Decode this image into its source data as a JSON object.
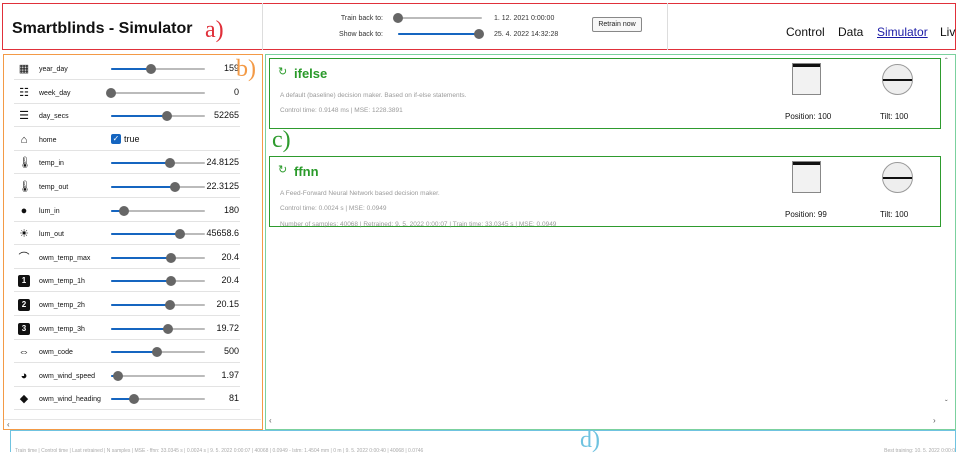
{
  "header": {
    "app_title": "Smartblinds - Simulator",
    "train_back_label": "Train back to:",
    "train_back_value": "1. 12. 2021 0:00:00",
    "show_back_label": "Show back to:",
    "show_back_value": "25. 4. 2022 14:32:28",
    "train_back_slider_fraction": 0.0,
    "show_back_slider_fraction": 0.97,
    "retrain_button": "Retrain now",
    "nav": [
      "Control",
      "Data",
      "Simulator",
      "Liv"
    ],
    "active_nav": "Simulator"
  },
  "annotations": {
    "a": "a)",
    "b": "b)",
    "c": "c)",
    "d": "d)"
  },
  "features": [
    {
      "name": "year_day",
      "icon": "calendar-icon",
      "value": "159",
      "fraction": 0.43
    },
    {
      "name": "week_day",
      "icon": "week-icon",
      "value": "0",
      "fraction": 0.0
    },
    {
      "name": "day_secs",
      "icon": "bars-icon",
      "value": "52265",
      "fraction": 0.6
    },
    {
      "name": "home",
      "icon": "home-icon",
      "checkbox": true,
      "value": "true"
    },
    {
      "name": "temp_in",
      "icon": "thermometer-icon",
      "value": "24.8125",
      "fraction": 0.63
    },
    {
      "name": "temp_out",
      "icon": "thermometer-out-icon",
      "value": "22.3125",
      "fraction": 0.68
    },
    {
      "name": "lum_in",
      "icon": "bulb-icon",
      "value": "180",
      "fraction": 0.14
    },
    {
      "name": "lum_out",
      "icon": "sun-icon",
      "value": "45658.6",
      "fraction": 0.73
    },
    {
      "name": "owm_temp_max",
      "icon": "arc-icon",
      "value": "20.4",
      "fraction": 0.64
    },
    {
      "name": "owm_temp_1h",
      "icon": "box-1-icon",
      "value": "20.4",
      "fraction": 0.64
    },
    {
      "name": "owm_temp_2h",
      "icon": "box-2-icon",
      "value": "20.15",
      "fraction": 0.63
    },
    {
      "name": "owm_temp_3h",
      "icon": "box-3-icon",
      "value": "19.72",
      "fraction": 0.61
    },
    {
      "name": "owm_code",
      "icon": "code-icon",
      "value": "500",
      "fraction": 0.49
    },
    {
      "name": "owm_wind_speed",
      "icon": "gauge-icon",
      "value": "1.97",
      "fraction": 0.07
    },
    {
      "name": "owm_wind_heading",
      "icon": "compass-icon",
      "value": "81",
      "fraction": 0.24
    }
  ],
  "models": [
    {
      "name": "ifelse",
      "description": "A default (baseline) decision maker. Based on if-else statements.",
      "lines": [
        "Control time: 0.9148 ms | MSE: 1228.3891"
      ],
      "position_label": "Position: 100",
      "tilt_label": "Tilt: 100",
      "position_fraction": 0.0,
      "tilt_value": 100
    },
    {
      "name": "ffnn",
      "description": "A Feed-Forward Neural Network based decision maker.",
      "lines": [
        "Control time: 0.0024 s | MSE: 0.0949",
        "Number of samples: 40068 | Retrained: 9. 5. 2022 0:00:07 | Train time: 33.0345 s | MSE: 0.0949"
      ],
      "position_label": "Position: 99",
      "tilt_label": "Tilt: 100",
      "position_fraction": 0.0,
      "tilt_value": 100
    }
  ],
  "footer": {
    "text": "Train time | Control time | Last retrained | N samples | MSE - ffnn: 33.0345 s | 0.0024 s | 9. 5. 2022 0:00:07 | 40068 | 0.0949 - lstm: 1.4504 mm | 0 m | 9. 5. 2022 0:00:40 | 40068 | 0.0746",
    "right_text": "Best training: 10. 5. 2022 0:00:0"
  },
  "colors": {
    "header_border": "#e0303a",
    "sidebar_border": "#f39a46",
    "main_border": "#7bd19e",
    "card_border": "#2e9b2e",
    "footer_border": "#6fc3e0",
    "slider_fill": "#1565c0"
  }
}
